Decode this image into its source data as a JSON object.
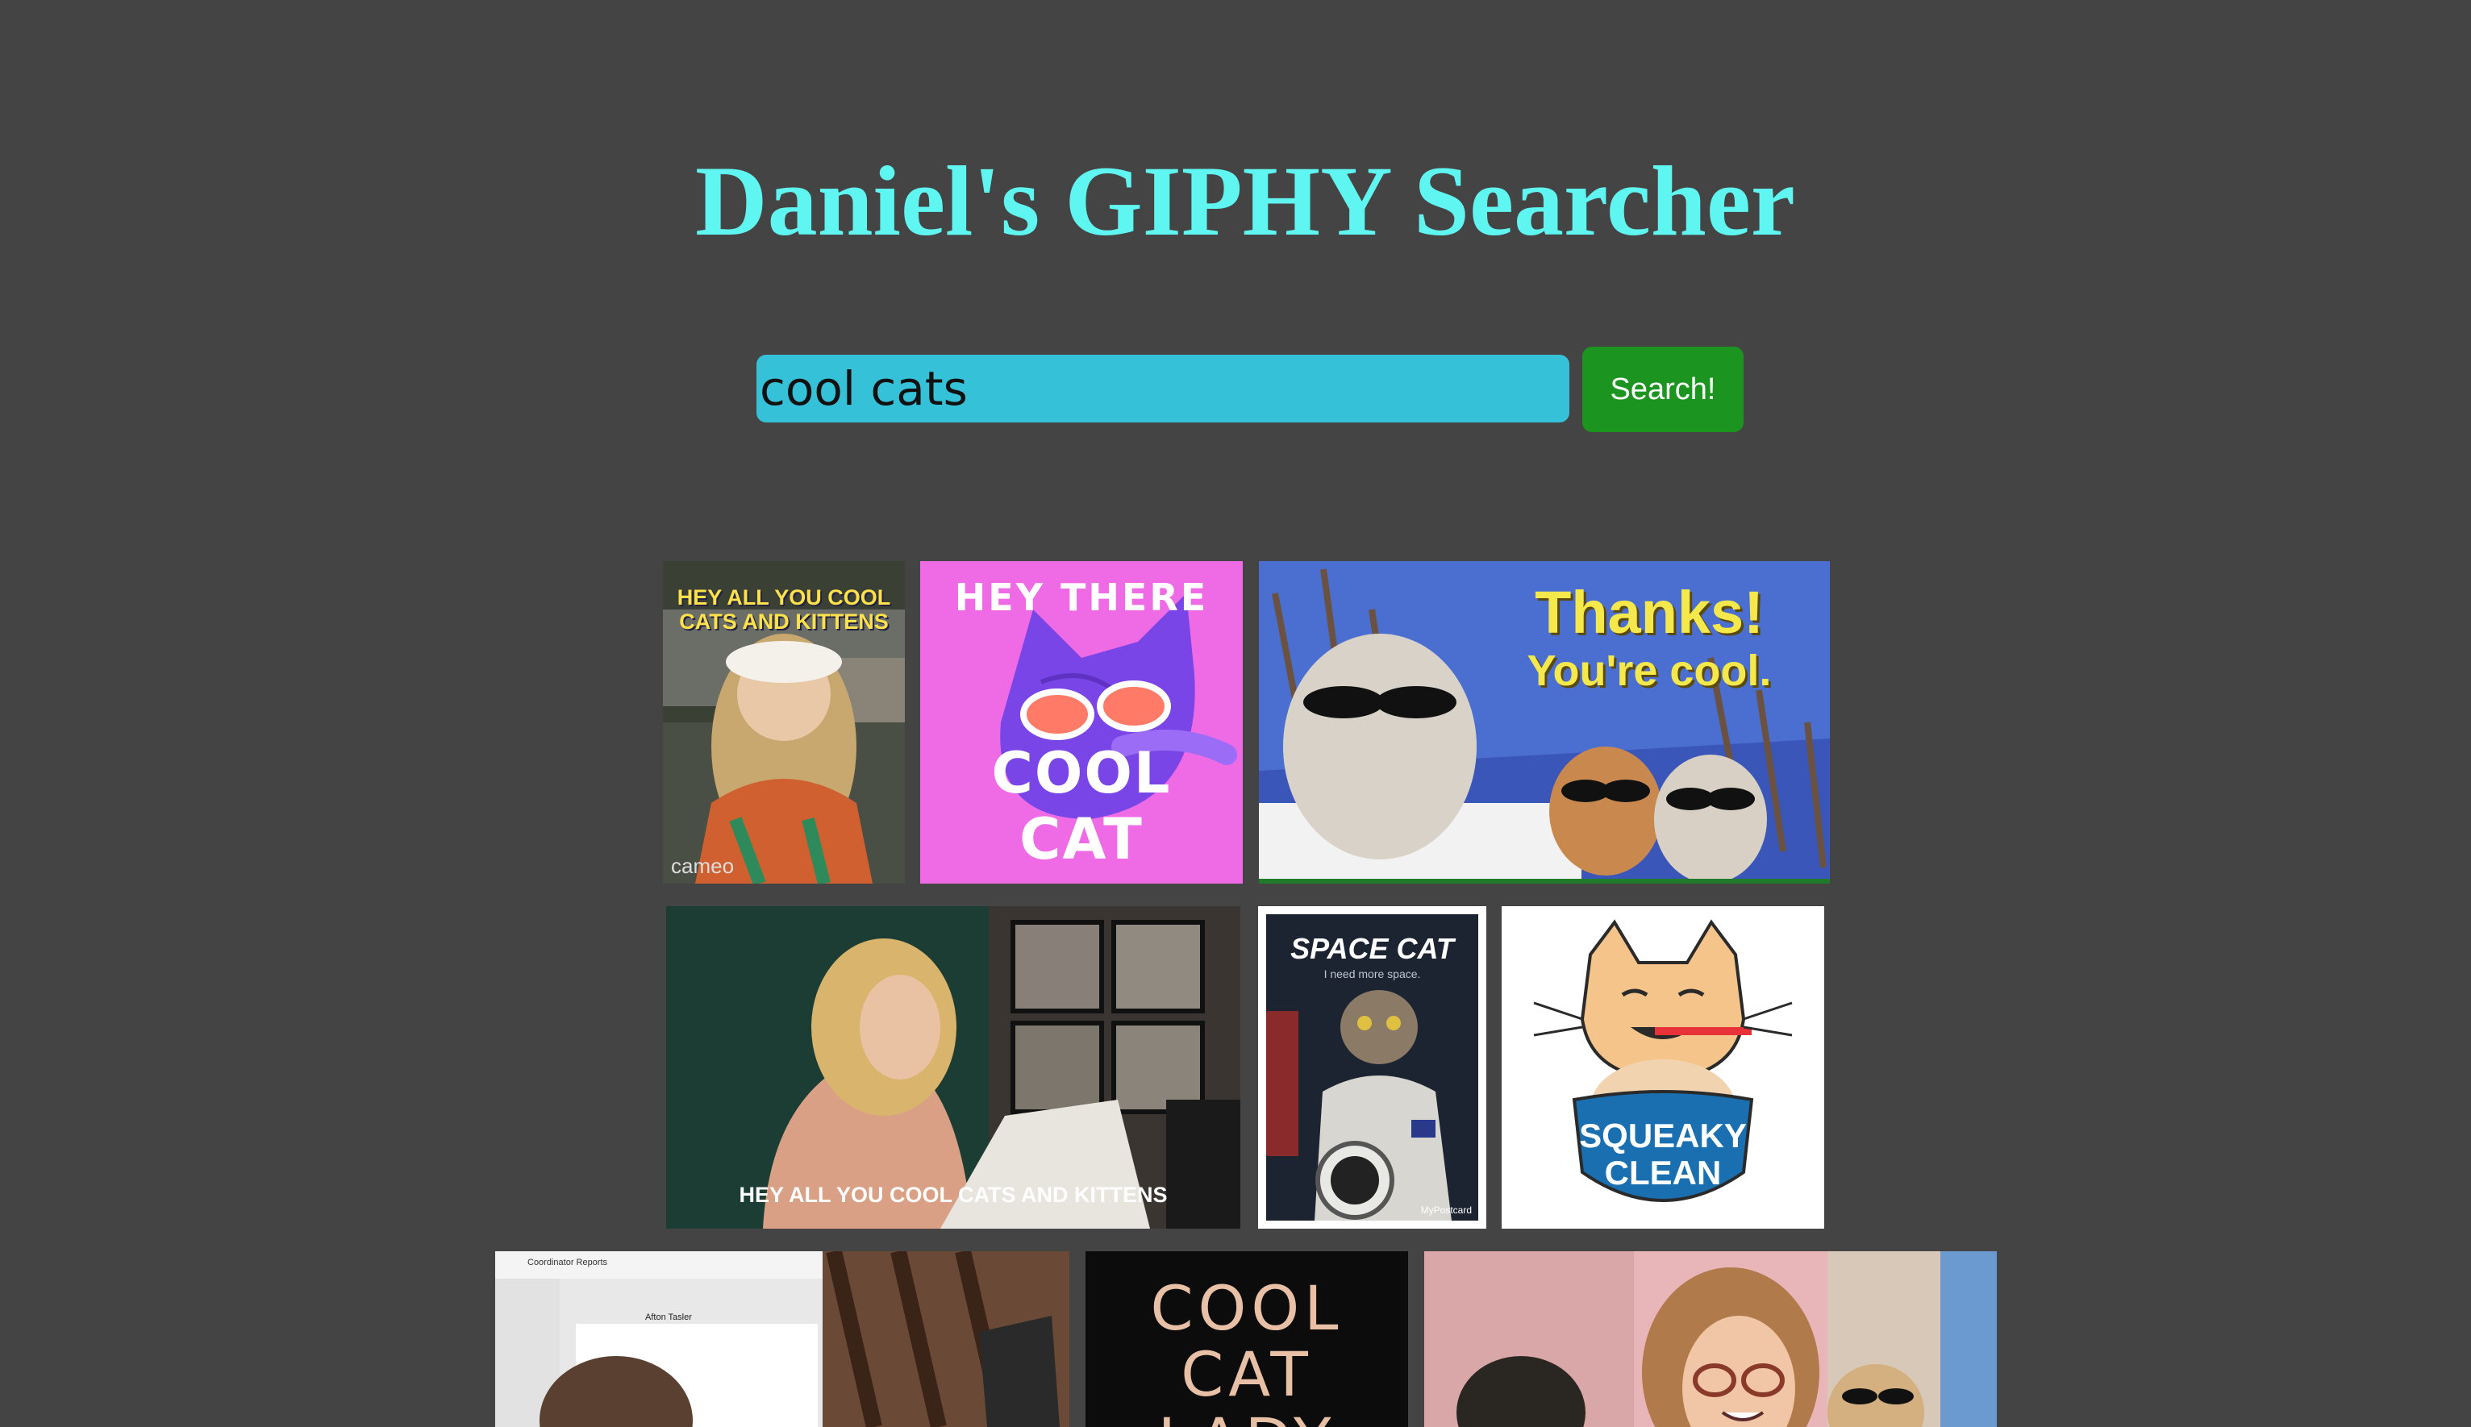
{
  "page": {
    "title": "Daniel's GIPHY Searcher"
  },
  "search": {
    "value": "cool cats",
    "button_label": "Search!"
  },
  "colors": {
    "background": "#444444",
    "title": "#5ff5f0",
    "input": "#35c1d8",
    "button": "#1b9420"
  },
  "results": [
    {
      "caption_lines": [
        "HEY ALL YOU COOL",
        "CATS AND KITTENS"
      ],
      "watermark": "cameo"
    },
    {
      "caption_top": "HEY THERE",
      "caption_bottom": "COOL CAT"
    },
    {
      "caption_lines": [
        "Thanks!",
        "You're cool."
      ]
    },
    {
      "caption": "HEY ALL YOU COOL CATS AND KITTENS"
    },
    {
      "caption": "SPACE CAT",
      "subcaption": "I need more space.",
      "watermark": "MyPostcard"
    },
    {
      "caption_lines": [
        "SQUEAKY",
        "CLEAN"
      ]
    },
    {
      "header_text": "Coordinator Reports",
      "post_author": "Afton Tasler"
    },
    {
      "caption_lines": [
        "COOL",
        "CAT",
        "LADY"
      ]
    },
    {}
  ]
}
